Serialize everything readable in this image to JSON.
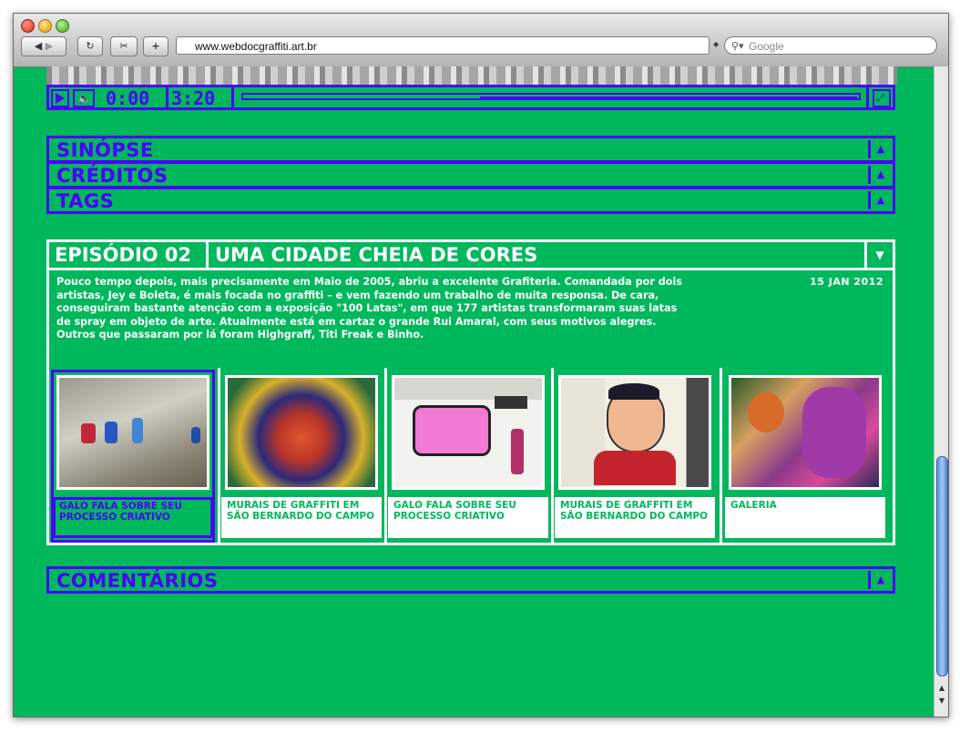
{
  "browser": {
    "url": "www.webdocgraffiti.art.br",
    "search_placeholder": "Google",
    "back_glyph": "◀",
    "forward_glyph": "▶",
    "reload_glyph": "↻",
    "add_glyph": "+"
  },
  "player": {
    "current_time": "0:00",
    "duration": "3:20"
  },
  "accordions": {
    "sinopse": "SINÓPSE",
    "creditos": "CRÉDITOS",
    "tags": "TAGS",
    "comentarios": "COMENTÁRIOS"
  },
  "episode": {
    "number": "EPISÓDIO 02",
    "title": "UMA CIDADE CHEIA DE CORES",
    "date": "15 JAN 2012",
    "description": "Pouco tempo depois, mais precisamente em Maio de 2005, abriu a excelente Grafiteria. Comandada por dois artistas, Jey e Boleta, é mais focada no graffiti – e vem fazendo um trabalho de muita responsa. De cara, conseguiram bastante atenção com a exposição \"100 Latas\", em que 177 artistas transformaram suas latas de spray em objeto de arte. Atualmente está em cartaz o grande Rui Amaral, com seus motivos alegres. Outros que passaram por lá foram Highgraff, Titi Freak e Binho.",
    "cards": [
      {
        "caption": "GALO FALA SOBRE SEU PROCESSO CRIATIVO"
      },
      {
        "caption": "MURAIS DE GRAFFITI EM SÃO BERNARDO DO CAMPO"
      },
      {
        "caption": "GALO FALA SOBRE SEU PROCESSO CRIATIVO"
      },
      {
        "caption": "MURAIS DE GRAFFITI EM SÃO BERNARDO DO CAMPO"
      },
      {
        "caption": "GALERIA"
      }
    ]
  },
  "colors": {
    "background": "#00b85c",
    "accent": "#4a00ff",
    "text": "#ffffff"
  },
  "icons": [
    "play-icon",
    "volume-icon",
    "fullscreen-icon",
    "collapse-up-icon",
    "expand-down-icon"
  ]
}
